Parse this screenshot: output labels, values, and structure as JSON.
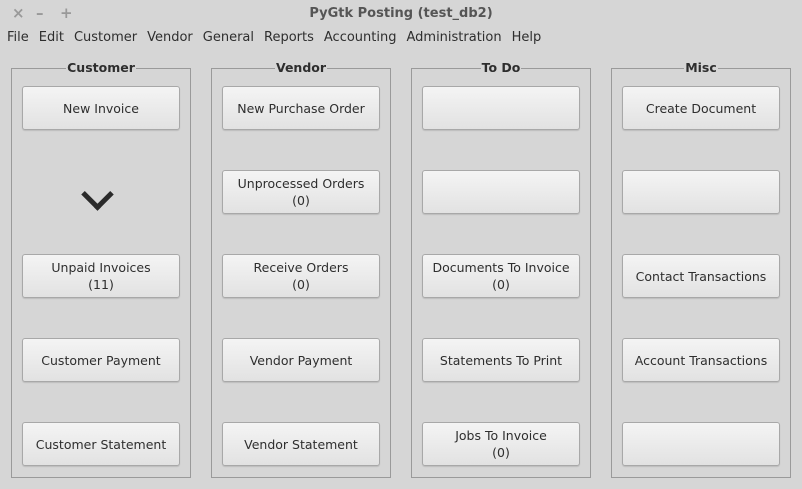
{
  "window": {
    "title": "PyGtk Posting (test_db2)",
    "close": "×",
    "minimize": "–",
    "maximize": "+"
  },
  "menu": [
    "File",
    "Edit",
    "Customer",
    "Vendor",
    "General",
    "Reports",
    "Accounting",
    "Administration",
    "Help"
  ],
  "customer": {
    "title": "Customer",
    "new_invoice": "New Invoice",
    "unpaid_invoices": "Unpaid Invoices",
    "unpaid_count": "(11)",
    "customer_payment": "Customer Payment",
    "customer_statement": "Customer Statement"
  },
  "vendor": {
    "title": "Vendor",
    "new_po": "New Purchase Order",
    "unprocessed": "Unprocessed Orders",
    "unprocessed_count": "(0)",
    "receive": "Receive Orders",
    "receive_count": "(0)",
    "payment": "Vendor Payment",
    "statement": "Vendor Statement"
  },
  "todo": {
    "title": "To Do",
    "docs_to_invoice": "Documents To Invoice",
    "docs_count": "(0)",
    "statements_to_print": "Statements To Print",
    "jobs_to_invoice": "Jobs To Invoice",
    "jobs_count": "(0)"
  },
  "misc": {
    "title": "Misc",
    "create_document": "Create Document",
    "contact_transactions": "Contact Transactions",
    "account_transactions": "Account Transactions"
  }
}
